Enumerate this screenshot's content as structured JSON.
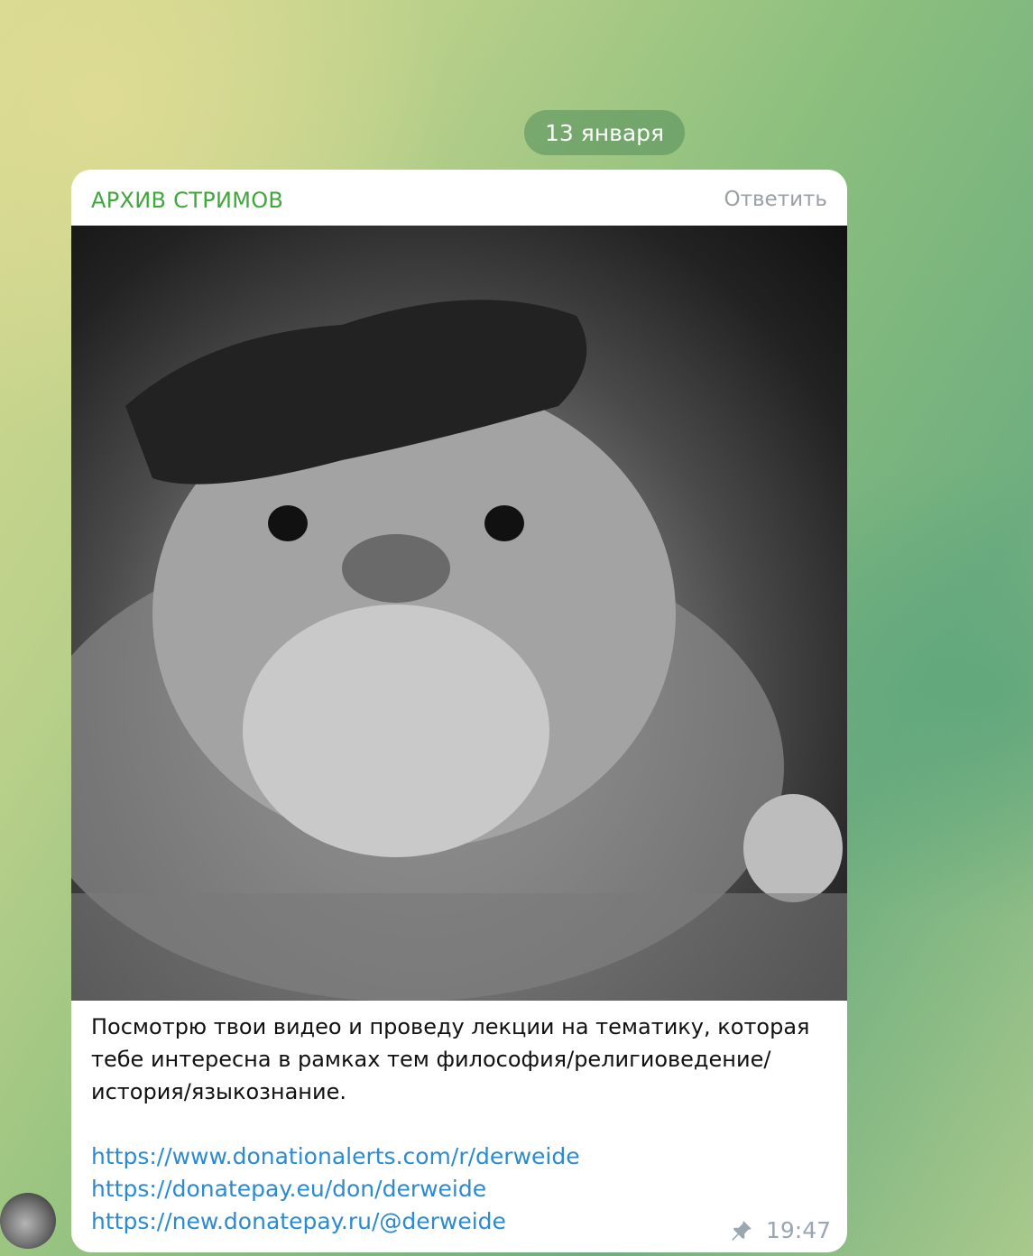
{
  "date_separator": "13 января",
  "message": {
    "sender": "АРХИВ СТРИМОВ",
    "reply_label": "Ответить",
    "photo_icon": "otter-photo",
    "caption": "Посмотрю твои видео и проведу лекции на тематику, которая тебе интересна в рамках тем философия/религиоведение/история/языкознание.",
    "links": [
      "https://www.donationalerts.com/r/derweide",
      "https://donatepay.eu/don/derweide",
      "https://new.donatepay.ru/@derweide"
    ],
    "pinned_icon": "pin-icon",
    "time": "19:47"
  }
}
